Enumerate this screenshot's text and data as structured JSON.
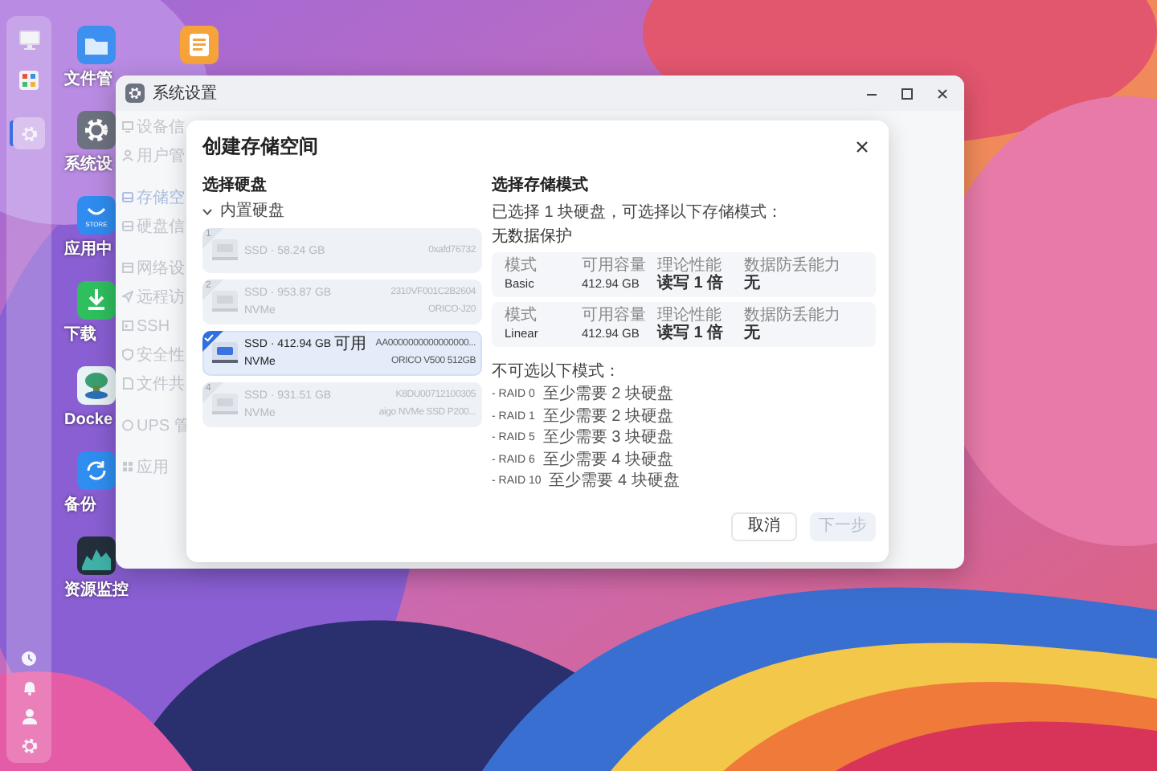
{
  "desktop": {
    "dock": {
      "top": [
        {
          "kind": "monitor",
          "selected": false
        },
        {
          "kind": "apps",
          "selected": false
        },
        {
          "kind": "settings",
          "selected": true
        }
      ],
      "bottom": [
        {
          "kind": "clock"
        },
        {
          "kind": "bell"
        },
        {
          "kind": "user"
        },
        {
          "kind": "settings"
        }
      ]
    },
    "icons": [
      {
        "kind": "folder",
        "label": "文件管"
      },
      {
        "kind": "settings",
        "label": "系统设"
      },
      {
        "kind": "store",
        "label": "应用中",
        "icon_text": "STORE"
      },
      {
        "kind": "download",
        "label": "下载"
      },
      {
        "kind": "docker",
        "label": "Docke"
      },
      {
        "kind": "backup",
        "label": "备份"
      },
      {
        "kind": "chart",
        "label": "资源监控"
      }
    ],
    "second_column": [
      {
        "kind": "notes"
      }
    ]
  },
  "settings_window": {
    "title": "系统设置",
    "sidebar": [
      {
        "items": [
          {
            "kind": "monitor",
            "label": "设备信",
            "selected": false
          },
          {
            "kind": "user",
            "label": "用户管",
            "selected": false
          }
        ]
      },
      {
        "items": [
          {
            "kind": "drive",
            "label": "存储空",
            "selected": true
          },
          {
            "kind": "disk",
            "label": "硬盘信",
            "selected": false
          }
        ]
      },
      {
        "items": [
          {
            "kind": "window",
            "label": "网络设",
            "selected": false
          },
          {
            "kind": "send",
            "label": "远程访",
            "selected": false
          },
          {
            "kind": "terminal",
            "label": "SSH",
            "selected": false
          },
          {
            "kind": "shield",
            "label": "安全性",
            "selected": false
          },
          {
            "kind": "document",
            "label": "文件共",
            "selected": false
          }
        ]
      },
      {
        "items": [
          {
            "kind": "circle",
            "label": "UPS 管",
            "selected": false
          }
        ]
      },
      {
        "items": [
          {
            "kind": "grid",
            "label": "应用",
            "selected": false
          }
        ]
      }
    ]
  },
  "dialog": {
    "title": "创建存储空间",
    "disks_title": "选择硬盘",
    "disk_group": {
      "label": "内置硬盘",
      "expanded": true
    },
    "disks": [
      {
        "number": "1",
        "title": "SSD · 58.24 GB",
        "id": "0xafd76732",
        "selected": false,
        "disabled": true
      },
      {
        "number": "2",
        "title": "SSD · 953.87 GB",
        "subtitle": "NVMe",
        "id": "2310VF001C2B2604",
        "model": "ORICO-J20",
        "selected": false,
        "disabled": true
      },
      {
        "title": "SSD · 412.94 GB",
        "tag": "可用",
        "subtitle": "NVMe",
        "id": "AA0000000000000000...",
        "model": "ORICO V500 512GB",
        "selected": true,
        "disabled": false
      },
      {
        "number": "4",
        "title": "SSD · 931.51 GB",
        "subtitle": "NVMe",
        "id": "K8DU00712100305",
        "model": "aigo NVMe SSD P200...",
        "selected": false,
        "disabled": true
      }
    ],
    "modes_title": "选择存储模式",
    "summary": "已选择 1 块硬盘，可选择以下存储模式：",
    "section": "无数据保护",
    "modes": [
      {
        "cells": [
          {
            "header": "模式",
            "value": "Basic"
          },
          {
            "header": "可用容量",
            "value": "412.94 GB"
          },
          {
            "header": "理论性能",
            "value": "读写 1 倍"
          },
          {
            "header": "数据防丢能力",
            "value": "无"
          }
        ]
      },
      {
        "cells": [
          {
            "header": "模式",
            "value": "Linear"
          },
          {
            "header": "可用容量",
            "value": "412.94 GB"
          },
          {
            "header": "理论性能",
            "value": "读写 1 倍"
          },
          {
            "header": "数据防丢能力",
            "value": "无"
          }
        ]
      }
    ],
    "unavailable_title": "不可选以下模式：",
    "unavailable": [
      {
        "name": "- RAID 0",
        "requirement": "至少需要 2 块硬盘"
      },
      {
        "name": "- RAID 1",
        "requirement": "至少需要 2 块硬盘"
      },
      {
        "name": "- RAID 5",
        "requirement": "至少需要 3 块硬盘"
      },
      {
        "name": "- RAID 6",
        "requirement": "至少需要 4 块硬盘"
      },
      {
        "name": "- RAID 10",
        "requirement": "至少需要 4 块硬盘"
      }
    ],
    "buttons": [
      {
        "label": "取消",
        "disabled": false
      },
      {
        "label": "下一步",
        "disabled": true
      }
    ]
  }
}
